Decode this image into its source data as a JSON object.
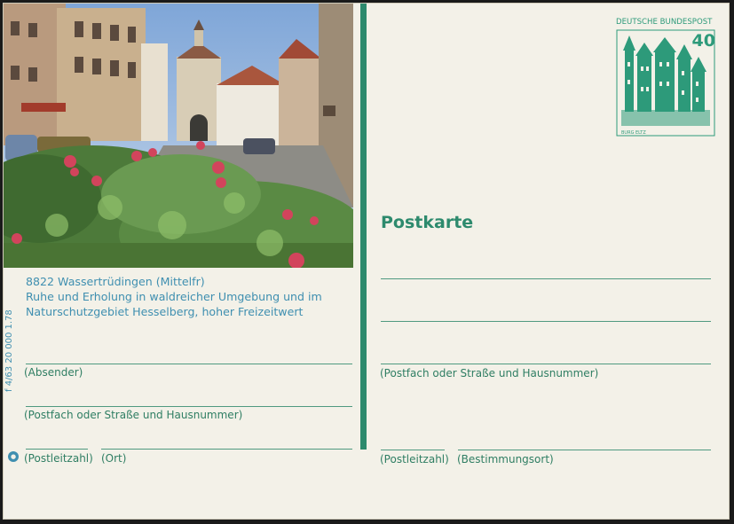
{
  "caption": {
    "line1": "8822 Wassertrüdingen (Mittelfr)",
    "line2": "Ruhe und Erholung in waldreicher Umgebung und im",
    "line3": "Naturschutzgebiet Hesselberg, hoher Freizeitwert"
  },
  "left_labels": {
    "sender": "(Absender)",
    "street": "(Postfach oder Straße und Hausnummer)",
    "zip": "(Postleitzahl)",
    "city": "(Ort)"
  },
  "serial": "f 4/63  20 000  1.78",
  "title": "Postkarte",
  "right_labels": {
    "street": "(Postfach oder Straße und Hausnummer)",
    "zip": "(Postleitzahl)",
    "destination": "(Bestimmungsort)"
  },
  "stamp": {
    "country": "DEUTSCHE BUNDESPOST",
    "value": "40",
    "caption": "BURG ELTZ"
  },
  "colors": {
    "card": "#f3f1e8",
    "green": "#2d8a6d",
    "blue_text": "#3f8fb0"
  }
}
